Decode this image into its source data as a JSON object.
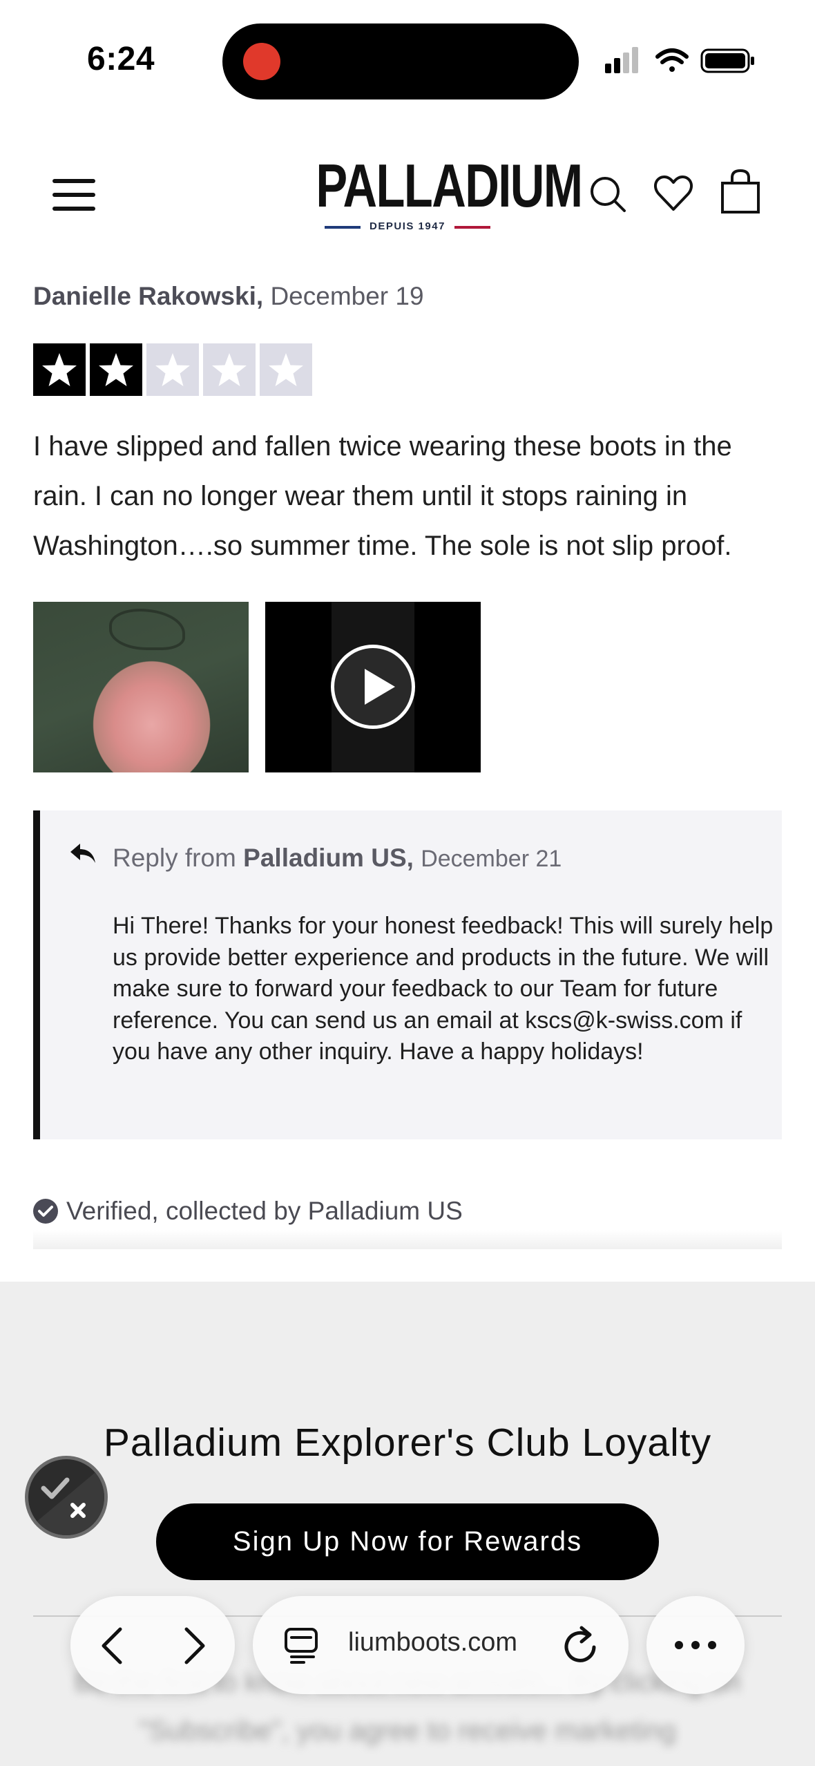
{
  "status_bar": {
    "time": "6:24"
  },
  "header": {
    "logo_text": "PALLADIUM",
    "logo_tagline": "DEPUIS 1947",
    "icons": [
      "menu-icon",
      "search-icon",
      "heart-icon",
      "bag-icon"
    ]
  },
  "review": {
    "author": "Danielle Rakowski,",
    "date": "December 19",
    "rating": 2,
    "rating_max": 5,
    "body": "I have slipped and fallen twice wearing these boots in the rain. I can no longer wear them until it stops raining in Washington….so summer time. The sole is not slip proof.",
    "reply": {
      "prefix": "Reply from",
      "author": "Palladium US,",
      "date": "December 21",
      "body": "Hi There! Thanks for your honest feedback! This will surely help us provide better experience and products in the future. We will make sure to forward your feedback to our Team for future reference. You can send us an email at kscs@k-swiss.com if you have any other inquiry. Have a happy holidays!"
    },
    "verified_text": "Verified, collected by Palladium US"
  },
  "loyalty": {
    "title": "Palladium Explorer's Club Loyalty",
    "button_label": "Sign Up Now for Rewards",
    "blurred_text": "Be the first to know about new arrivals... By clicking on \"Subscribe\", you agree to receive marketing"
  },
  "browser": {
    "url": "liumboots.com"
  },
  "colors": {
    "star_on": "#000000",
    "star_off": "#dcdce6",
    "reply_bg": "#f4f4f7",
    "loyalty_bg": "#eeeeee",
    "record_dot": "#e0392b"
  }
}
